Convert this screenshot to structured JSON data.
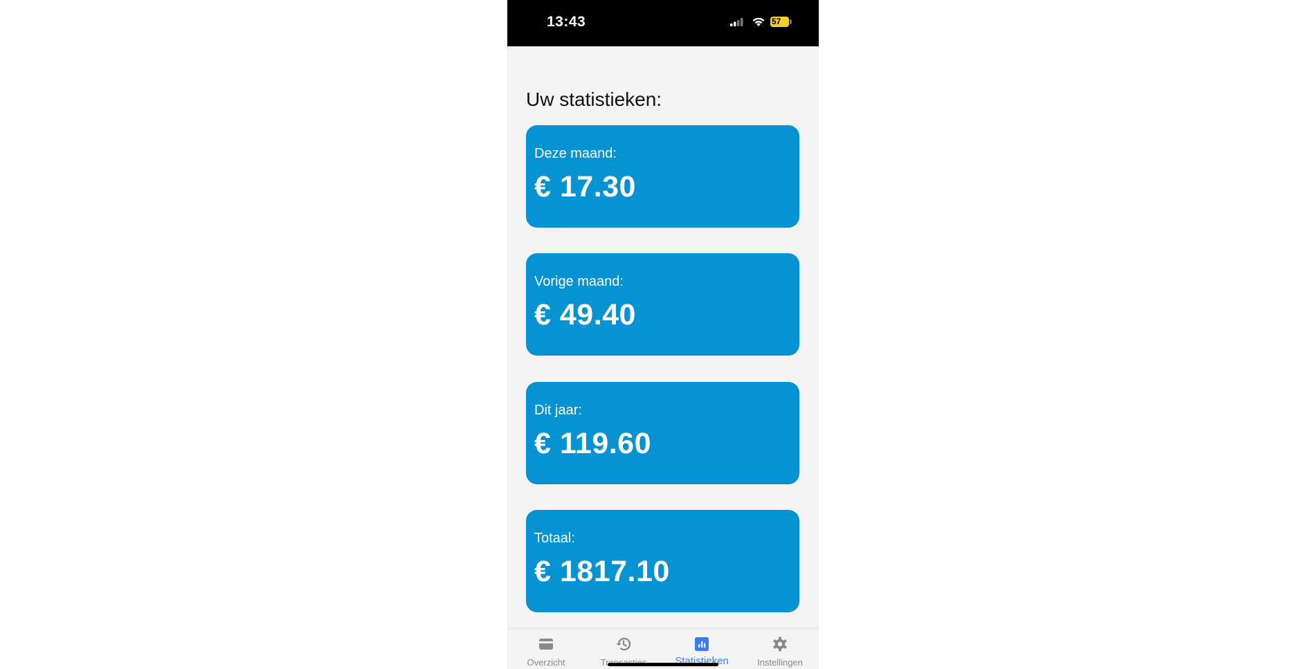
{
  "status_bar": {
    "time": "13:43",
    "battery": "57"
  },
  "page": {
    "title": "Uw statistieken:"
  },
  "cards": [
    {
      "label": "Deze maand:",
      "value": "€ 17.30"
    },
    {
      "label": "Vorige maand:",
      "value": "€ 49.40"
    },
    {
      "label": "Dit jaar:",
      "value": "€ 119.60"
    },
    {
      "label": "Totaal:",
      "value": "€ 1817.10"
    }
  ],
  "tabs": [
    {
      "label": "Overzicht",
      "icon": "wallet-icon",
      "active": false
    },
    {
      "label": "Transacties",
      "icon": "history-icon",
      "active": false
    },
    {
      "label": "Statistieken",
      "icon": "bar-chart-icon",
      "active": true
    },
    {
      "label": "Instellingen",
      "icon": "gear-icon",
      "active": false
    }
  ],
  "colors": {
    "card": "#0592d2",
    "active_tab": "#3d7cf2",
    "inactive_tab": "#8a8a8a",
    "battery": "#f5d020"
  }
}
